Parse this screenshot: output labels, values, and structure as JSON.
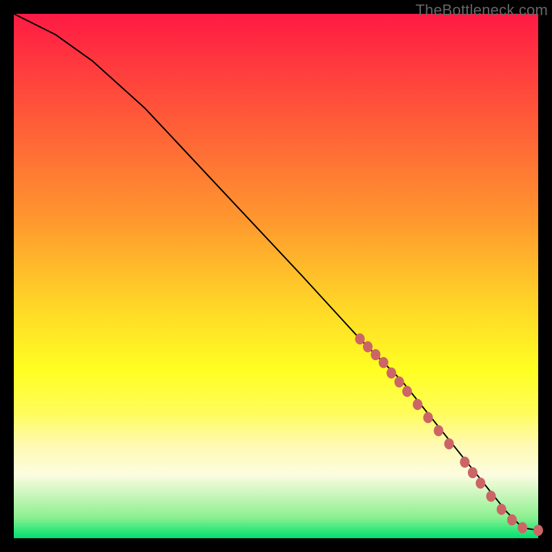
{
  "watermark": "TheBottleneck.com",
  "colors": {
    "bg": "#000000",
    "gradient_top": "#ff1a44",
    "gradient_mid": "#ffff22",
    "gradient_bottom": "#00e070",
    "curve": "#000000",
    "markers": "#cc6666"
  },
  "chart_data": {
    "type": "line",
    "title": "",
    "xlabel": "",
    "ylabel": "",
    "xlim": [
      0,
      100
    ],
    "ylim": [
      0,
      100
    ],
    "series": [
      {
        "name": "curve",
        "x": [
          0,
          3,
          8,
          15,
          25,
          40,
          55,
          66,
          70,
          74,
          78,
          82,
          86,
          90,
          94,
          97,
          100
        ],
        "y": [
          100,
          98.5,
          96,
          91,
          82,
          66,
          50,
          38,
          34,
          30,
          25,
          20,
          15,
          10,
          5,
          2,
          1.5
        ]
      }
    ],
    "markers": [
      {
        "x": 66,
        "y": 38
      },
      {
        "x": 67.5,
        "y": 36.5
      },
      {
        "x": 69,
        "y": 35
      },
      {
        "x": 70.5,
        "y": 33.5
      },
      {
        "x": 72,
        "y": 31.5
      },
      {
        "x": 73.5,
        "y": 29.8
      },
      {
        "x": 75,
        "y": 28
      },
      {
        "x": 77,
        "y": 25.5
      },
      {
        "x": 79,
        "y": 23
      },
      {
        "x": 81,
        "y": 20.5
      },
      {
        "x": 83,
        "y": 18
      },
      {
        "x": 86,
        "y": 14.5
      },
      {
        "x": 87.5,
        "y": 12.5
      },
      {
        "x": 89,
        "y": 10.5
      },
      {
        "x": 91,
        "y": 8
      },
      {
        "x": 93,
        "y": 5.5
      },
      {
        "x": 95,
        "y": 3.5
      },
      {
        "x": 97,
        "y": 2
      },
      {
        "x": 100,
        "y": 1.5
      }
    ],
    "marker_radius_px": 7
  }
}
